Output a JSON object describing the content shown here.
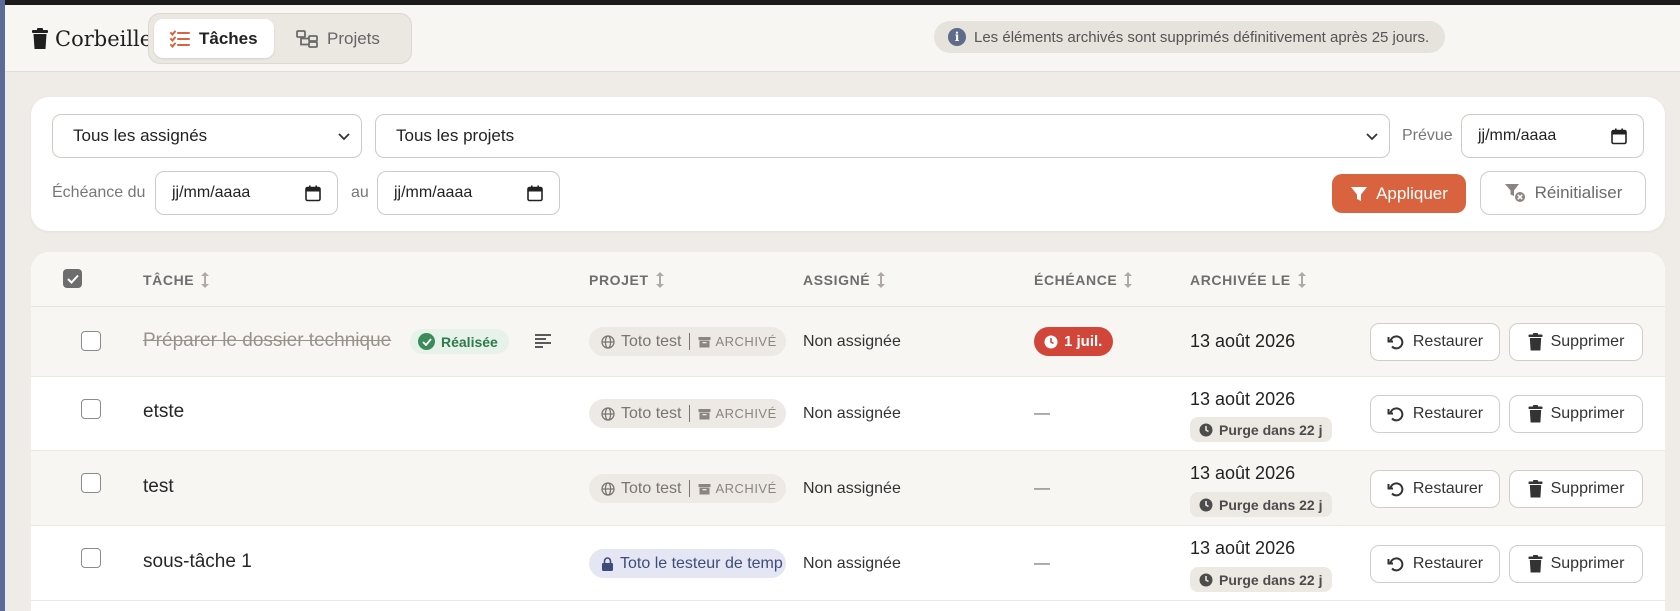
{
  "header": {
    "brand": "Corbeille",
    "tabs": [
      {
        "label": "Tâches",
        "active": true
      },
      {
        "label": "Projets",
        "active": false
      }
    ],
    "notice": "Les éléments archivés sont supprimés définitivement après 25 jours."
  },
  "filters": {
    "assignee_select": "Tous les assignés",
    "project_select": "Tous les projets",
    "planned_label": "Prévue",
    "planned_placeholder": "jj/mm/aaaa",
    "due_from_label": "Échéance du",
    "due_from_placeholder": "jj/mm/aaaa",
    "due_to_label": "au",
    "due_to_placeholder": "jj/mm/aaaa",
    "apply_label": "Appliquer",
    "reset_label": "Réinitialiser"
  },
  "table": {
    "columns": [
      "TÂCHE",
      "PROJET",
      "ASSIGNÉ",
      "ÉCHÉANCE",
      "ARCHIVÉE LE"
    ],
    "rows": [
      {
        "task": "Préparer le dossier technique",
        "status": "Réalisée",
        "project": "Toto test",
        "project_archived": "ARCHIVÉ",
        "assignee": "Non assignée",
        "due": "1 juil.",
        "archived_on": "13 août 2026",
        "purge": "",
        "restore": "Restaurer",
        "delete": "Supprimer"
      },
      {
        "task": "etste",
        "project": "Toto test",
        "project_archived": "ARCHIVÉ",
        "assignee": "Non assignée",
        "due": "—",
        "archived_on": "13 août 2026",
        "purge": "Purge dans 22 j",
        "restore": "Restaurer",
        "delete": "Supprimer"
      },
      {
        "task": "test",
        "project": "Toto test",
        "project_archived": "ARCHIVÉ",
        "assignee": "Non assignée",
        "due": "—",
        "archived_on": "13 août 2026",
        "purge": "Purge dans 22 j",
        "restore": "Restaurer",
        "delete": "Supprimer"
      },
      {
        "task": "sous-tâche 1",
        "project": "Toto le testeur de temp",
        "assignee": "Non assignée",
        "due": "—",
        "archived_on": "13 août 2026",
        "purge": "Purge dans 22 j",
        "restore": "Restaurer",
        "delete": "Supprimer"
      }
    ]
  },
  "colors": {
    "accent": "#d9633e",
    "danger": "#d2463a",
    "success": "#3b8c5a",
    "private_project": "#3f4c7a"
  }
}
